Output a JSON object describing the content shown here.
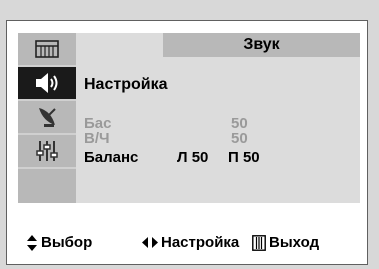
{
  "menu": {
    "header": "Звук",
    "subtitle": "Настройка",
    "sidebar": [
      {
        "icon": "picture-icon",
        "active": false
      },
      {
        "icon": "speaker-icon",
        "active": true
      },
      {
        "icon": "antenna-icon",
        "active": false
      },
      {
        "icon": "equalizer-icon",
        "active": false
      },
      {
        "icon": "",
        "active": false
      }
    ],
    "items": [
      {
        "label": "Бас",
        "value": "50",
        "enabled": false
      },
      {
        "label": "В/Ч",
        "value": "50",
        "enabled": false
      },
      {
        "label": "Баланс",
        "left": "Л 50",
        "right": "П 50",
        "enabled": true
      }
    ]
  },
  "footer": {
    "select_label": "Выбор",
    "adjust_label": "Настройка",
    "exit_label": "Выход"
  }
}
